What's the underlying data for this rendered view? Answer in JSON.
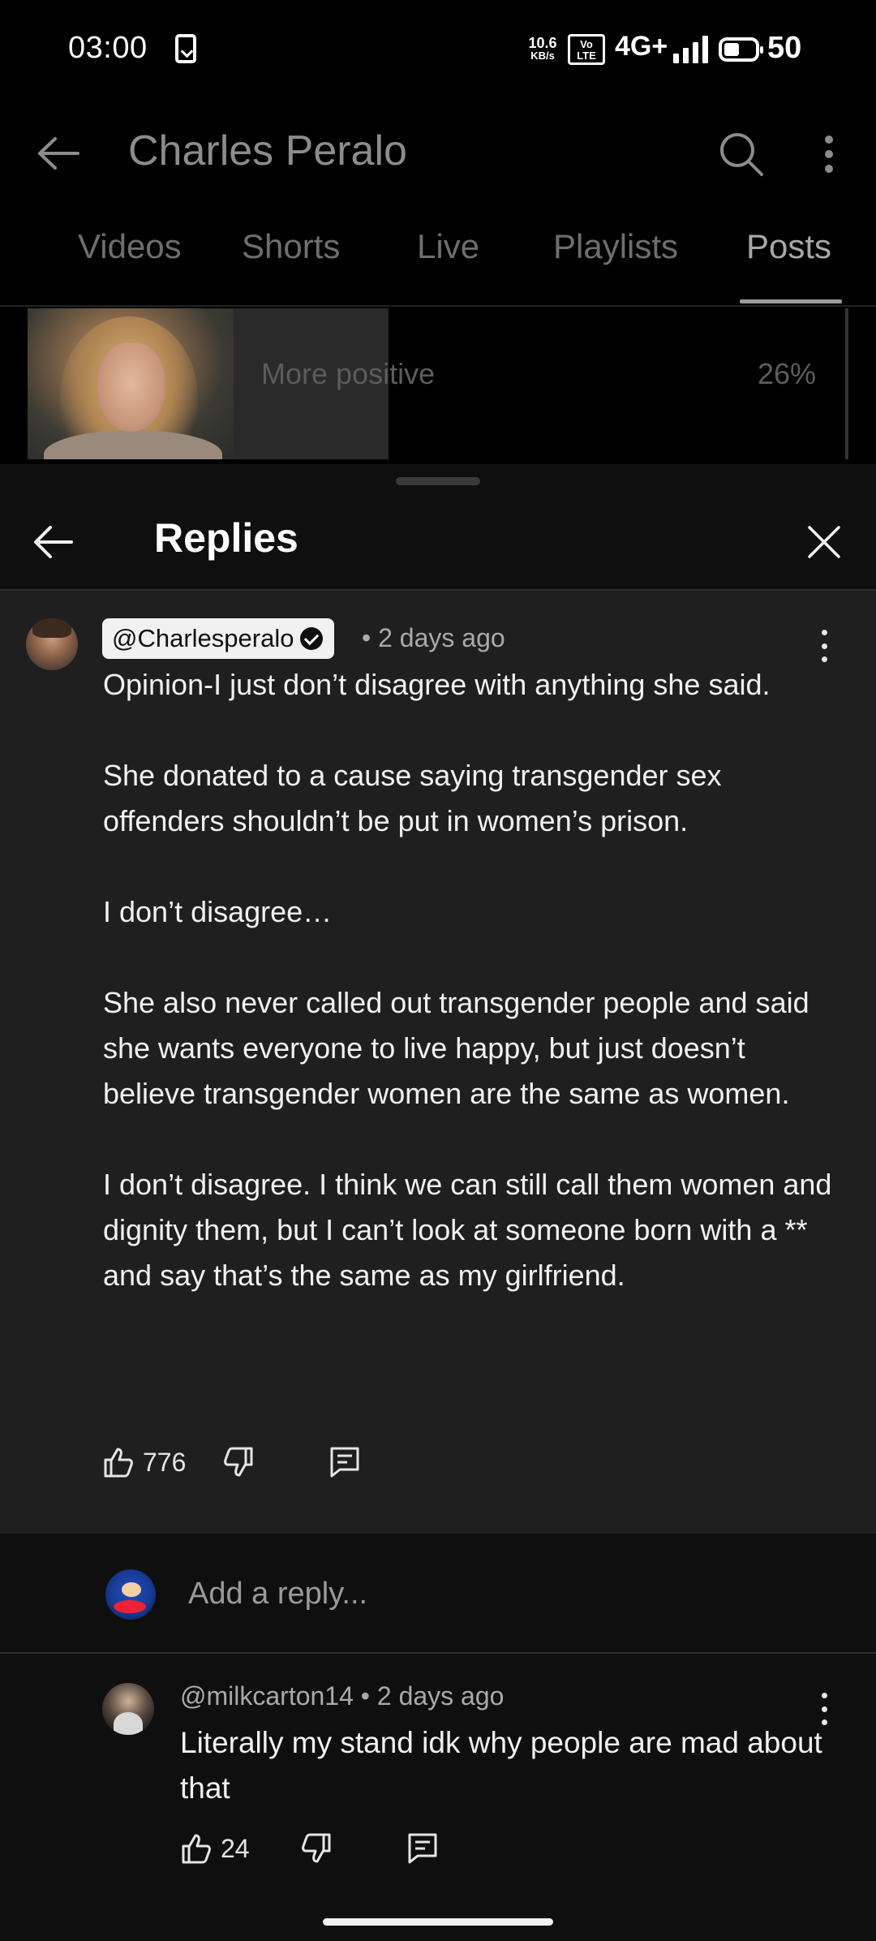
{
  "status_bar": {
    "time": "03:00",
    "net_speed_value": "10.6",
    "net_speed_unit": "KB/s",
    "volte_top": "Vo",
    "volte_bottom": "LTE",
    "network": "4G+",
    "battery": "50"
  },
  "header": {
    "title": "Charles Peralo"
  },
  "tabs": [
    {
      "label": "Videos"
    },
    {
      "label": "Shorts"
    },
    {
      "label": "Live"
    },
    {
      "label": "Playlists"
    },
    {
      "label": "Posts"
    }
  ],
  "active_tab": "Posts",
  "poll": {
    "option_label": "More positive",
    "option_percent": "26%",
    "option_fraction": 0.26
  },
  "sheet": {
    "title": "Replies"
  },
  "main_comment": {
    "author": "@Charlesperalo",
    "time": "• 2 days ago",
    "paragraphs": [
      "Opinion-I just don’t disagree with anything she said.",
      "She donated to a cause saying transgender sex offenders shouldn’t be put in women’s prison.",
      "I don’t disagree…",
      "She also never called out transgender people and said she wants everyone to live happy, but just doesn’t believe transgender women are the same as women.",
      "I don’t disagree. I think we can still call them women and dignity them, but I can’t look at someone born with a ** and say that’s the same as my girlfriend."
    ],
    "likes": "776"
  },
  "add_reply": {
    "placeholder": "Add a reply..."
  },
  "reply": {
    "author_time": "@milkcarton14 • 2 days ago",
    "text": "Literally my stand idk why people are mad about that",
    "likes": "24"
  },
  "colors": {
    "background": "#000000",
    "sheet_background": "#0f0f0f",
    "highlight_comment_background": "#1f1f1f",
    "primary_text": "#f1f1f1",
    "secondary_text": "#aaaaaa"
  }
}
